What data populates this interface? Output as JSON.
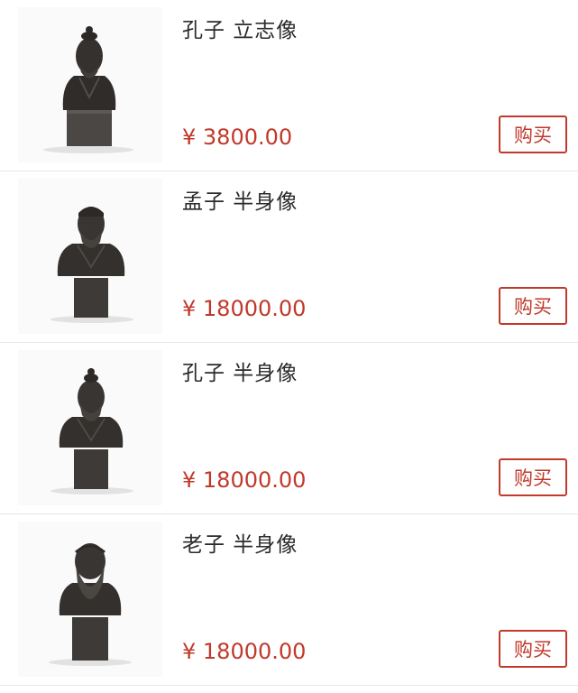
{
  "accent_color": "#c0392b",
  "products": [
    {
      "name": "孔子 立志像",
      "price": "¥ 3800.00",
      "buy_label": "购买",
      "image_icon": "confucius-standing-statue-icon"
    },
    {
      "name": "孟子 半身像",
      "price": "¥ 18000.00",
      "buy_label": "购买",
      "image_icon": "mencius-bust-icon"
    },
    {
      "name": "孔子 半身像",
      "price": "¥ 18000.00",
      "buy_label": "购买",
      "image_icon": "confucius-bust-icon"
    },
    {
      "name": "老子 半身像",
      "price": "¥ 18000.00",
      "buy_label": "购买",
      "image_icon": "laozi-bust-icon"
    }
  ]
}
